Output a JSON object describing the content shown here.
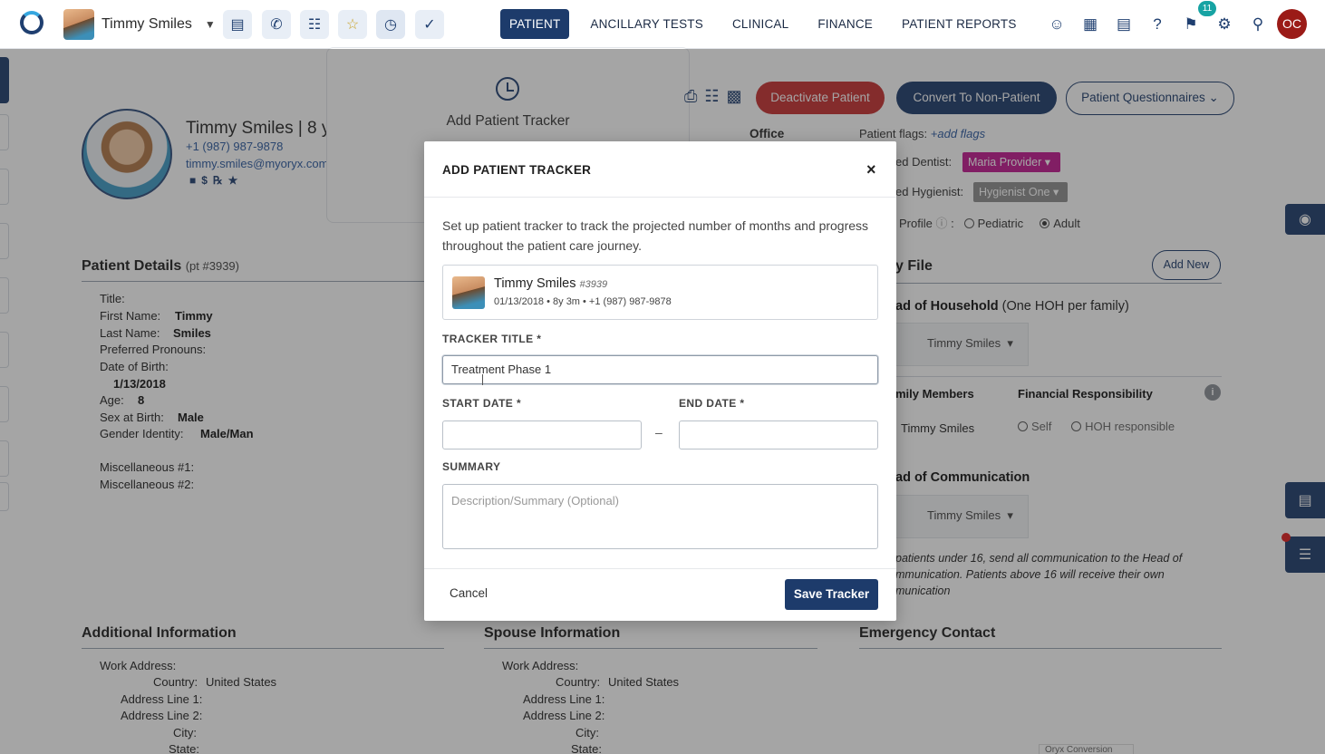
{
  "topbar": {
    "user_name": "Timmy Smiles",
    "nav_tabs": [
      "PATIENT",
      "ANCILLARY TESTS",
      "CLINICAL",
      "FINANCE",
      "PATIENT REPORTS"
    ],
    "notification_count": "11",
    "user_initials": "OC"
  },
  "patient": {
    "name_line": "Timmy Smiles | 8 yea",
    "phone": "+1 (987) 987-9878",
    "email": "timmy.smiles@myoryx.com"
  },
  "tracker_popover": {
    "label": "Add Patient Tracker"
  },
  "header_actions": {
    "deactivate": "Deactivate Patient",
    "convert": "Convert To Non-Patient",
    "questionnaires": "Patient Questionnaires"
  },
  "office": {
    "label": "Office",
    "flags_label": "Patient flags:",
    "add_flags": "+add flags",
    "dentist_label": "ed Dentist:",
    "dentist_value": "Maria Provider",
    "hygienist_label": "ed Hygienist:",
    "hygienist_value": "Hygienist One",
    "profile_label": "Profile",
    "profile_options": [
      "Pediatric",
      "Adult"
    ],
    "profile_selected": "Adult"
  },
  "details": {
    "title": "Patient Details",
    "pt_number": "(pt #3939)",
    "fields": [
      {
        "label": "Title:",
        "value": ""
      },
      {
        "label": "First Name:",
        "value": "Timmy"
      },
      {
        "label": "Last Name:",
        "value": "Smiles"
      },
      {
        "label": "Preferred Pronouns:",
        "value": ""
      },
      {
        "label": "Date of Birth:",
        "value": "1/13/2018"
      },
      {
        "label": "Age:",
        "value": "8"
      },
      {
        "label": "Sex at Birth:",
        "value": "Male"
      },
      {
        "label": "Gender Identity:",
        "value": "Male/Man"
      },
      {
        "label": "Miscellaneous #1:",
        "value": ""
      },
      {
        "label": "Miscellaneous #2:",
        "value": ""
      }
    ]
  },
  "family": {
    "title": "y File",
    "add_new": "Add New",
    "hoh_title": "ad of Household",
    "hoh_note": "(One HOH per family)",
    "hoh_member": "Timmy Smiles",
    "members_header": "mily Members",
    "fin_header": "Financial Responsibility",
    "member_name": "Timmy Smiles",
    "fin_options": [
      "Self",
      "HOH responsible"
    ],
    "hoc_title": "ad of Communication",
    "hoc_member": "Timmy Smiles",
    "hoc_note": "patients under 16, send all communication to the Head of mmunication. Patients above 16 will receive their own munication"
  },
  "bottom": {
    "additional_title": "Additional Information",
    "spouse_title": "Spouse Information",
    "emergency_title": "Emergency Contact",
    "work_address": "Work Address:",
    "country_label": "Country:",
    "country_value": "United States",
    "addr1": "Address Line 1:",
    "addr2": "Address Line 2:",
    "city": "City:",
    "state": "State:",
    "footer_tag": "Oryx Conversion"
  },
  "modal": {
    "title": "ADD PATIENT TRACKER",
    "close": "×",
    "description": "Set up patient tracker to track the projected number of months and progress throughout the patient care journey.",
    "patient_name": "Timmy Smiles",
    "patient_id": "#3939",
    "patient_meta": "01/13/2018 • 8y 3m  •  +1 (987) 987-9878",
    "tracker_title_label": "TRACKER TITLE *",
    "tracker_title_value": "Treatment Phase 1",
    "start_date_label": "START DATE *",
    "start_date_value": "",
    "end_date_label": "END DATE *",
    "end_date_value": "",
    "date_separator": "–",
    "summary_label": "SUMMARY",
    "summary_placeholder": "Description/Summary (Optional)",
    "cancel": "Cancel",
    "save": "Save Tracker"
  }
}
